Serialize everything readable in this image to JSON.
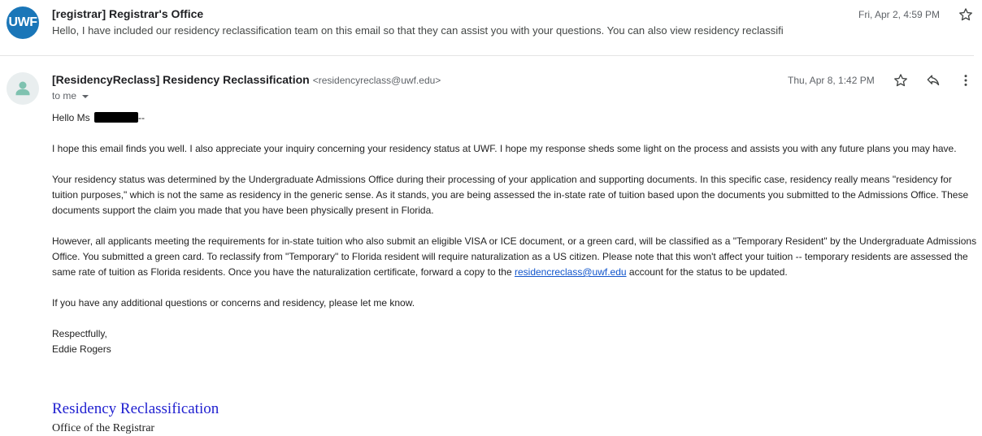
{
  "collapsed_message": {
    "logo_text": "UWF",
    "sender": "[registrar] Registrar's Office",
    "snippet": "Hello, I have included our residency reclassification team on this email so that they can assist you with your questions. You can also view residency reclassifi",
    "date": "Fri, Apr 2, 4:59 PM",
    "star_icon": "star-outline-icon"
  },
  "expanded_message": {
    "sender_name": "[ResidencyReclass] Residency Reclassification",
    "sender_email": "<residencyreclass@uwf.edu>",
    "recipient": "to me",
    "date": "Thu, Apr 8, 1:42 PM",
    "icons": [
      "star-outline-icon",
      "reply-icon",
      "more-vert-icon",
      "person-icon",
      "chevron-down-icon"
    ],
    "greeting_prefix": "Hello Ms",
    "greeting_suffix": "--",
    "paragraphs": [
      "I hope this email finds you well. I also appreciate your inquiry concerning your residency status at UWF. I hope my response sheds some light on the process and assists you with any future plans you may have.",
      "Your residency status was determined by the Undergraduate Admissions Office during their processing of your application and supporting documents. In this specific case, residency really means \"residency for tuition purposes,\" which is not the same as residency in the generic sense. As it stands, you are being assessed the in-state rate of tuition based upon the documents you submitted to the Admissions Office. These documents support the claim you made that you have been physically present in Florida."
    ],
    "paragraph_link": {
      "before": "However, all applicants meeting the requirements for in-state tuition who also submit an eligible VISA or ICE document, or a green card, will be classified as a \"Temporary Resident\" by the Undergraduate Admissions Office. You submitted a green card. To reclassify from \"Temporary\" to Florida resident will require naturalization as a US citizen. Please note that this won't affect your tuition -- temporary residents are assessed the same rate of tuition as Florida residents. Once you have the naturalization certificate, forward a copy to the",
      "link_text": "residencreclass@uwf.edu",
      "after": "account for the status to be updated."
    },
    "closing_paragraph": "If you have any additional questions or concerns and residency, please let me know.",
    "signoff": "Respectfully,",
    "signer": "Eddie Rogers",
    "signature_title": "Residency Reclassification",
    "signature_office": "Office of the Registrar"
  },
  "colors": {
    "logo_blue": "#1a76b8",
    "link_blue": "#1155cc",
    "signature_blue": "#1f1fd0",
    "avatar_bg": "#e9eeef",
    "avatar_fg": "#7fc2b0"
  }
}
